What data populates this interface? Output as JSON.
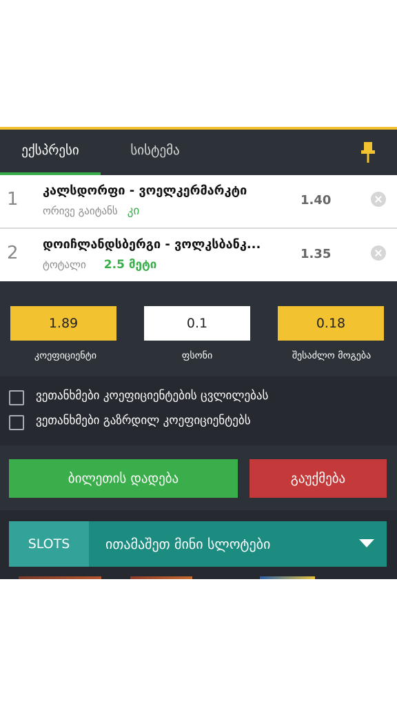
{
  "tabs": {
    "express": "ექსპრესი",
    "system": "სისტემა"
  },
  "bets": [
    {
      "num": "1",
      "title": "კალსდორფი - ვოელკერმარკტი",
      "type": "ორივე გაიტანს",
      "pick": "კი",
      "odd": "1.40"
    },
    {
      "num": "2",
      "title": "დოიჩლანდსბერგი - ვოლკსბანკ...",
      "type": "ტოტალი",
      "pick": "2.5 მეტი",
      "odd": "1.35"
    }
  ],
  "values": {
    "coef": "1.89",
    "coef_label": "კოეფიციენტი",
    "stake": "0.1",
    "stake_label": "ფსონი",
    "win": "0.18",
    "win_label": "შესაძლო მოგება"
  },
  "checks": {
    "odds_change": "ვეთანხმები კოეფიციენტების ცვლილებას",
    "boosted": "ვეთანხმები გაზრდილ კოეფიციენტებს"
  },
  "actions": {
    "place": "ბილეთის დადება",
    "clear": "გაუქმება"
  },
  "slots": {
    "tag": "SLOTS",
    "text": "ითამაშეთ მინი სლოტები"
  },
  "colors": {
    "accent_yellow": "#f2c230",
    "green": "#3aae4b",
    "red": "#c43a3a",
    "teal": "#1c8c80",
    "dark": "#2d3138"
  }
}
